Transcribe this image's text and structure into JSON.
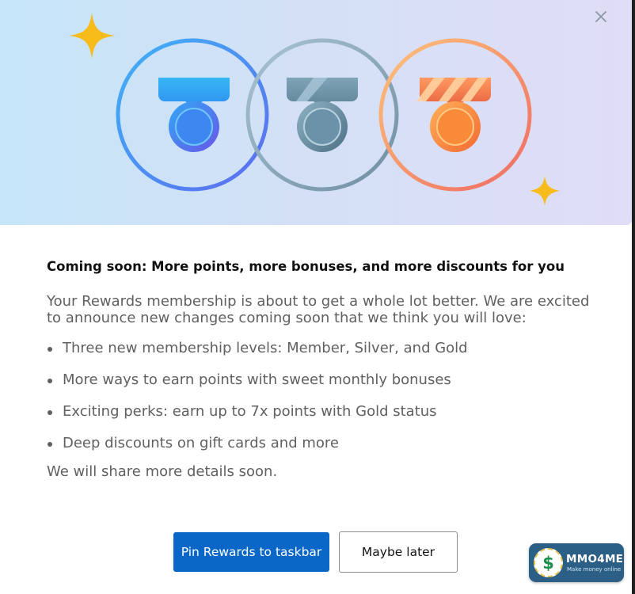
{
  "dialog": {
    "close_icon": "close-icon",
    "heading": "Coming soon: More points, more bonuses, and more discounts for you",
    "intro": "Your Rewards membership is about to get a whole lot better. We are excited to announce new changes coming soon that we think you will love:",
    "bullets": [
      "Three new membership levels: Member, Silver, and Gold",
      "More ways to earn points with sweet monthly bonuses",
      "Exciting perks: earn up to 7x points with Gold status",
      "Deep discounts on gift cards and more"
    ],
    "outro": "We will share more details soon.",
    "primary_button": "Pin Rewards to taskbar",
    "secondary_button": "Maybe later"
  },
  "hero": {
    "medals": [
      "blue-medal-icon",
      "silver-medal-icon",
      "bronze-medal-icon"
    ],
    "sparkles": [
      "sparkle-icon",
      "sparkle-icon"
    ]
  },
  "watermark": {
    "logo_glyph": "$",
    "title": "MMO4ME",
    "subtitle": "Make money online"
  },
  "colors": {
    "primary": "#0a67c8",
    "sparkle": "#f7bb1a",
    "blue_ring": "#3d8ef2",
    "silver_ring": "#8fb0c4",
    "bronze_ring": "#f49a6a"
  }
}
